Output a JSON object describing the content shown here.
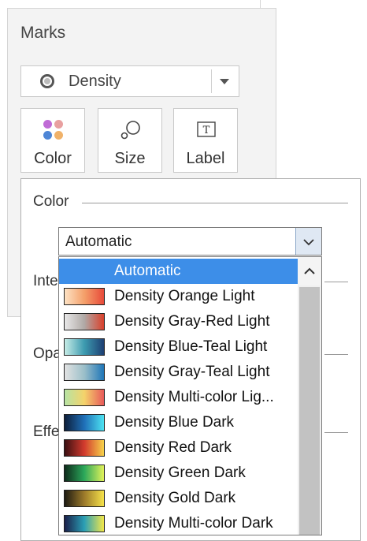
{
  "marks": {
    "title": "Marks",
    "mark_type": "Density",
    "shelves": {
      "color": "Color",
      "size": "Size",
      "label": "Label"
    }
  },
  "color_panel": {
    "heading": "Color",
    "partial_labels": {
      "intensity": "Inte",
      "opacity": "Opa",
      "effects": "Effe"
    },
    "select_value": "Automatic",
    "options": [
      {
        "label": "Automatic",
        "selected": true
      },
      {
        "label": "Density Orange Light",
        "gradient": [
          "#fde2c4",
          "#f4a06a",
          "#e84a3a"
        ]
      },
      {
        "label": "Density Gray-Red Light",
        "gradient": [
          "#e8e8e8",
          "#b0a9a6",
          "#d9402b"
        ]
      },
      {
        "label": "Density Blue-Teal Light",
        "gradient": [
          "#c6ece6",
          "#3d9bb0",
          "#1d3f73"
        ]
      },
      {
        "label": "Density Gray-Teal Light",
        "gradient": [
          "#e2e2e2",
          "#9bbfc9",
          "#1f76b8"
        ]
      },
      {
        "label": "Density Multi-color Lig...",
        "gradient": [
          "#b6e3a4",
          "#f4d36b",
          "#e85a5a"
        ]
      },
      {
        "label": "Density Blue Dark",
        "gradient": [
          "#0d1e3a",
          "#1f6fb8",
          "#4de3f2"
        ]
      },
      {
        "label": "Density Red Dark",
        "gradient": [
          "#3a0f12",
          "#d23a2d",
          "#f7d24a"
        ]
      },
      {
        "label": "Density Green Dark",
        "gradient": [
          "#0d2a1b",
          "#2ba85a",
          "#e2f25a"
        ]
      },
      {
        "label": "Density Gold Dark",
        "gradient": [
          "#1d1a12",
          "#9c7a2a",
          "#f6e24a"
        ]
      },
      {
        "label": "Density Multi-color Dark",
        "gradient": [
          "#1a1f4a",
          "#2a9fb5",
          "#f3e84a"
        ]
      }
    ]
  },
  "colors": {
    "selection": "#3d8ee8",
    "shelf_dots": [
      "#c06bd6",
      "#e8a0a0",
      "#4e86d6",
      "#f0b26a"
    ]
  }
}
